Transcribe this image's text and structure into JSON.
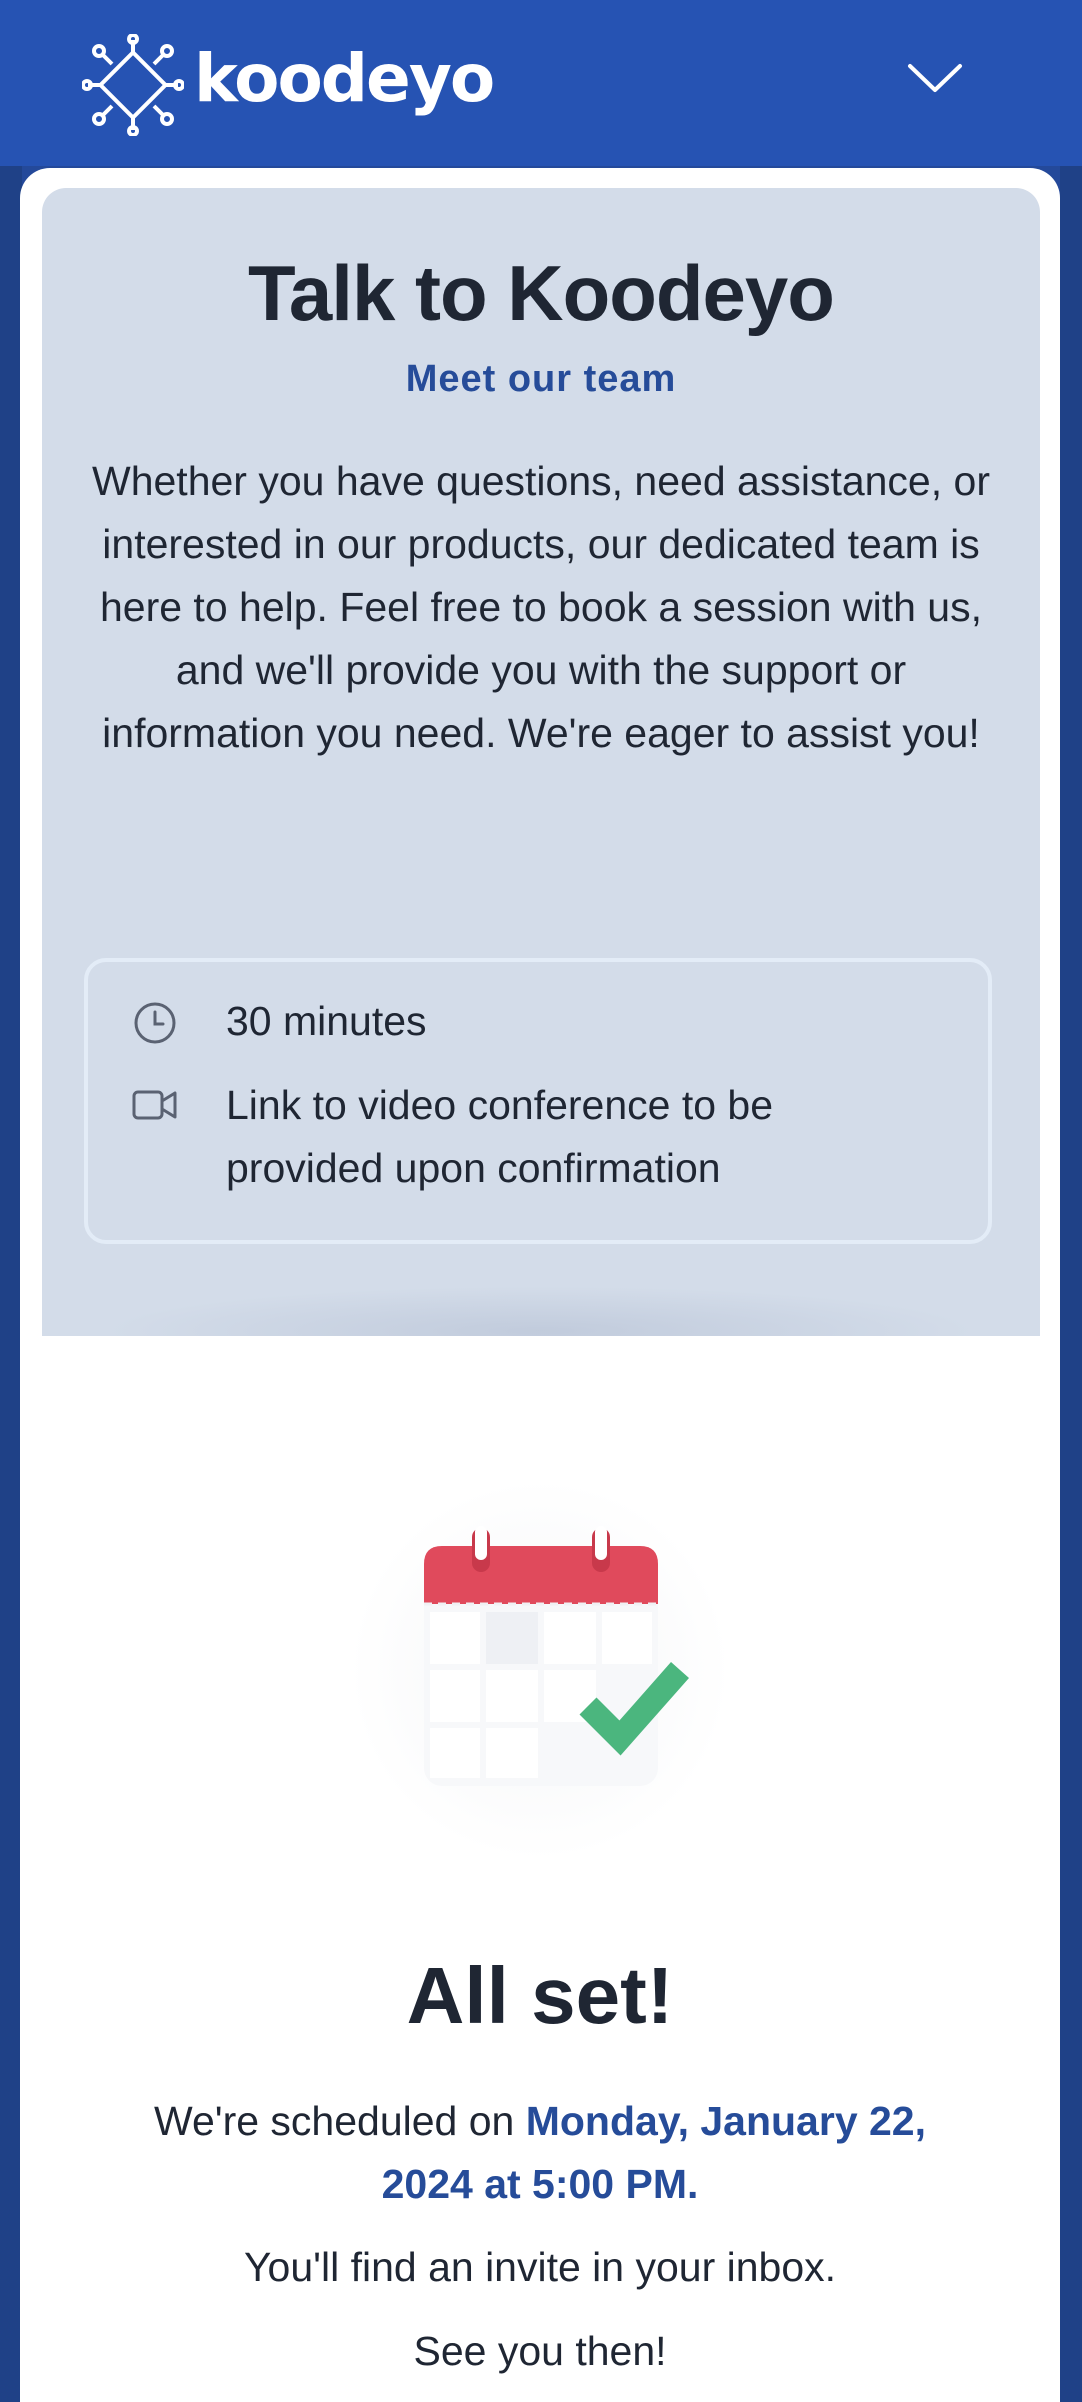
{
  "header": {
    "brand": "koodeyo",
    "logo_icon": "circuit-chip-icon",
    "menu_icon": "chevron-down-icon"
  },
  "booking": {
    "title": "Talk to Koodeyo",
    "subtitle": "Meet our team",
    "description": "Whether you have questions, need assistance, or interested in our products, our dedicated team is here to help. Feel free to book a session with us, and we'll provide you with the support or information you need. We're eager to assist you!",
    "details": [
      {
        "icon": "clock-icon",
        "text": "30 minutes"
      },
      {
        "icon": "video-camera-icon",
        "text": "Link to video conference to be provided upon confirmation"
      }
    ]
  },
  "confirmation": {
    "illustration_icon": "calendar-check-icon",
    "title": "All set!",
    "scheduled_prefix": "We're scheduled on ",
    "scheduled_when": "Monday, January 22, 2024 at 5:00 PM.",
    "invite_note": "You'll find an invite in your inbox.",
    "closing": "See you then!"
  },
  "colors": {
    "header_bg": "#2653b3",
    "panel_bg": "#d3dce9",
    "accent": "#264c99",
    "calendar_red": "#e04a5c",
    "check_green": "#4bb67e"
  }
}
